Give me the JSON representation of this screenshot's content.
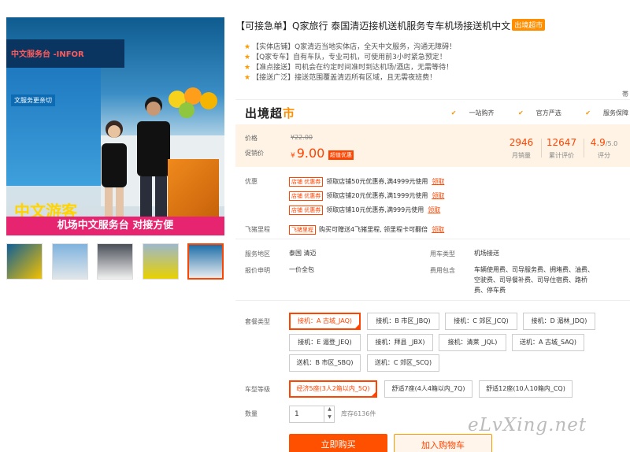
{
  "gallery": {
    "sign_text": "中文服务台 -INFOR",
    "blue_label": "文服务更亲切",
    "logo_text": "中文游客",
    "banner_text": "机场中文服务台  对接方便",
    "thumb_count": 5,
    "active_thumb": 5
  },
  "product": {
    "title": "【可接急单】Q家旅行 泰国清迈接机送机服务专车机场接送机中文",
    "title_badge": "出境超市",
    "features": [
      "【实体店铺】Q家清迈当地实体店，全天中文服务，沟通无障碍！",
      "【Q家专车】自有车队，专业司机，可使用前3小时紧急预定！",
      "【准点接送】司机会在约定时间准时到达机场/酒店，无需等待！",
      "【接送广泛】接送范围覆盖清迈所有区域，且无需夜班费！"
    ],
    "edge_label": "帯"
  },
  "chaoshi": {
    "logo_a": "出境超",
    "logo_b": "市",
    "tags": [
      "一站购齐",
      "官方严选",
      "服务保障"
    ]
  },
  "price": {
    "label_price": "价格",
    "original": "¥22.00",
    "label_promo": "促销价",
    "currency": "¥",
    "current": "9.00",
    "promo_tag": "超值优惠",
    "stats": [
      {
        "num": "2946",
        "label": "月销量"
      },
      {
        "num": "12647",
        "label": "累计评价"
      },
      {
        "num": "4.9",
        "suffix": "/5.0",
        "label": "评分"
      }
    ]
  },
  "promos": {
    "label": "优惠",
    "tag": "店铺 优惠券",
    "get": "领取",
    "items": [
      "领取店铺50元优惠券,满4999元使用",
      "领取店铺20元优惠券,满1999元使用",
      "领取店铺10元优惠券,满999元使用"
    ],
    "miles_label": "飞猪里程",
    "miles_tag": "飞猪里程",
    "miles_text": "购买可赠送4飞猪里程, 领里程卡可翻倍",
    "miles_get": "领取"
  },
  "info": {
    "area_label": "服务地区",
    "area_val": "泰国  清迈",
    "usecar_label": "用车类型",
    "usecar_val": "机场接送",
    "quote_label": "报价申明",
    "quote_val": "一价全包",
    "cost_label": "费用包含",
    "cost_lines": [
      "车辆使用费、司导服务费、拥堵费、油费、",
      "空驶费、司导餐补费、司导住宿费、路桥",
      "费、停车费"
    ]
  },
  "package": {
    "label": "套餐类型",
    "options": [
      "接机：A 古城_JAQ)",
      "接机：B 市区_JBQ)",
      "接机：C 郊区_JCQ)",
      "接机：D 湄林_JDQ)",
      "接机：E 湄登_JEQ)",
      "接机：拜县 _JBX)",
      "接机：清莱 _JQL)",
      "送机：A 古城_SAQ)",
      "送机：B 市区_SBQ)",
      "送机：C 郊区_SCQ)"
    ],
    "selected": 0
  },
  "car": {
    "label": "车型等级",
    "options": [
      "经济5座(3人2箱以内_5Q)",
      "舒适7座(4人4箱以内_7Q)",
      "舒适12座(10人10箱内_CQ)"
    ],
    "selected": 0
  },
  "quantity": {
    "label": "数量",
    "value": "1",
    "up": "▲",
    "down": "▼",
    "stock": "库存6136件"
  },
  "actions": {
    "buy": "立即购买",
    "cart": "加入购物车"
  },
  "watermark": "eLvXing.net",
  "colors": {
    "accent": "#ff4400",
    "orange": "#ff8f00",
    "pricebg": "#fef3e4"
  }
}
